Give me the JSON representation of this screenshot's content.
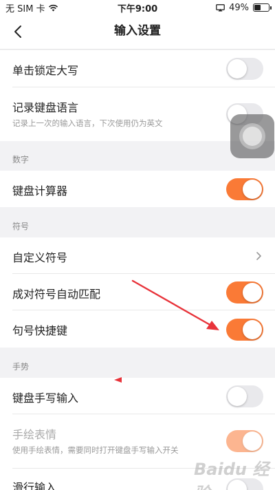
{
  "status": {
    "carrier": "无 SIM 卡",
    "time": "下午9:00",
    "battery_pct": "49%",
    "battery_level": 0.49
  },
  "nav": {
    "title": "输入设置"
  },
  "rows": {
    "caps_lock": {
      "label": "单击锁定大写",
      "on": false
    },
    "keyboard_lang": {
      "label": "记录键盘语言",
      "desc": "记录上一次的输入语言，下次使用仍为英文",
      "on": false
    },
    "calculator": {
      "label": "键盘计算器",
      "on": true
    },
    "custom_symbols": {
      "label": "自定义符号"
    },
    "pair_symbols": {
      "label": "成对符号自动匹配",
      "on": true
    },
    "period_shortcut": {
      "label": "句号快捷键",
      "on": true
    },
    "handwriting": {
      "label": "键盘手写输入",
      "on": false
    },
    "hand_drawn_emoji": {
      "label": "手绘表情",
      "desc": "使用手绘表情，需要同时打开键盘手写输入开关",
      "on": true,
      "disabled": true
    },
    "swipe_input": {
      "label": "滑行输入"
    }
  },
  "sections": {
    "digits": "数字",
    "symbols": "符号",
    "gestures": "手势"
  },
  "watermark": {
    "text": "Baidu 经验"
  },
  "colors": {
    "accent": "#fa7a36",
    "arrow": "#e8333a"
  },
  "icons": {
    "back": "chevron-left-icon",
    "chevron": "chevron-right-icon",
    "wifi": "wifi-icon",
    "screen_mirror": "screen-mirror-icon"
  }
}
